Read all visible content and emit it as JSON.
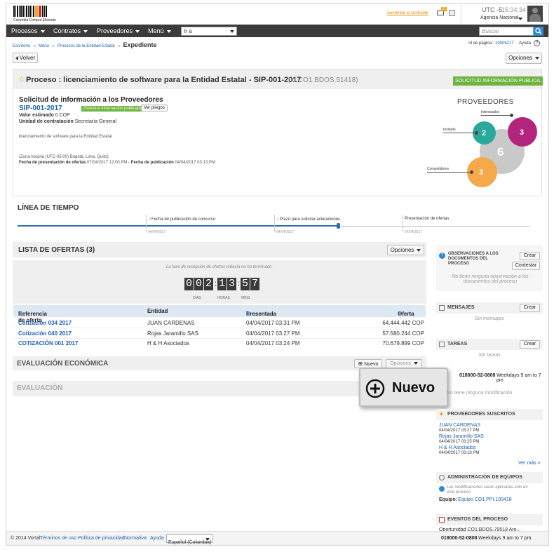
{
  "header": {
    "logo_text": "Colombia Compra Eficiente",
    "increase_contrast": "Aumentar el contraste",
    "notif_count": "31",
    "utc": "UTC -5",
    "time": "15:34:34",
    "agency": "Agencia Nacional..."
  },
  "nav": {
    "items": [
      "Procesos",
      "Contratos",
      "Proveedores",
      "Menú"
    ],
    "ira_placeholder": "Ir a",
    "search_placeholder": "Buscar"
  },
  "breadcrumb": {
    "items": [
      "Escritorio",
      "Menú",
      "Procesos de la Entidad Estatal"
    ],
    "current": "Expediente",
    "page_id_label": "Id de página::",
    "page_id": "10005217",
    "help": "Ayuda"
  },
  "actions": {
    "back": "Volver",
    "options": "Opciones"
  },
  "process": {
    "title": "Proceso : licenciamiento de software para la Entidad Estatal - SIP-001-2017",
    "code": "(id.CO1.BDOS.51418)",
    "status_badge": "SOLICITUD INFORMACIÓN PUBLICA...",
    "subtitle": "Solicitud de información a los Proveedores",
    "number": "SIP-001-2017",
    "number_status": "(Solicitud información publicada)",
    "view_button": "Ver pliegos",
    "est_value_label": "Valor estimado",
    "est_value": "0 COP",
    "unit_label": "Unidad de contratación",
    "unit": "Secretaría General",
    "description": "licenciamiento de software para la Entidad Estatal",
    "timezone": "(Zona horaria (UTC-05:00) Bogotá, Lima, Quito)",
    "offers_date_label": "Fecha de presentación de ofertas",
    "offers_date": "07/04/2017 12:00 PM",
    "pub_date_label": "Fecha de publicación",
    "pub_date": "04/04/2017 03:13 PM"
  },
  "suppliers_chart": {
    "title": "PROVEEDORES",
    "labels": {
      "interested": "Interesados",
      "invited": "Invitado",
      "competitors": "Competidores"
    },
    "values": {
      "total": "6",
      "interested": "3",
      "invited": "2",
      "competitors": "3"
    },
    "colors": {
      "interested": "#b3247c",
      "invited": "#2aa99b",
      "competitors": "#f5a94a",
      "total": "#c9c9c9"
    }
  },
  "timeline": {
    "title": "LÍNEA DE TIEMPO",
    "events": [
      {
        "label": "Fecha de publicación de concurso",
        "date": "04/04/2017"
      },
      {
        "label": "Plazo para solicitar aclaraciones",
        "date": "04/04/2017"
      },
      {
        "label": "Presentación de ofertas",
        "date": "07/04/2017"
      }
    ]
  },
  "offers": {
    "title": "LISTA DE OFERTAS (3)",
    "options": "Opciones",
    "notice": "La fase de recepción de ofertas todavía no ha terminado.",
    "countdown": {
      "days": "002",
      "hours": "13",
      "mins": "57",
      "days_label": "DÍAS",
      "hours_label": "HORAS",
      "mins_label": "MINS"
    },
    "columns": [
      "Referencia de oferta",
      "Entidad",
      "Presentada",
      "Oferta"
    ],
    "rows": [
      {
        "ref": "Cotización 034 2017",
        "entity": "JUAN CARDENAS",
        "date": "04/04/2017 03:31 PM",
        "amount": "64.444.442 COP"
      },
      {
        "ref": "Cotización 040 2017",
        "entity": "Rojas Jaramillo SAS",
        "date": "04/04/2017 03:27 PM",
        "amount": "57.580.244 COP"
      },
      {
        "ref": "COTIZACIÓN 001 2017",
        "entity": "H & H Asociados",
        "date": "04/04/2017 03:24 PM",
        "amount": "70.679.899 COP"
      }
    ]
  },
  "eval_econ": {
    "title": "EVALUACIÓN ECONÓMICA",
    "new": "Nuevo",
    "options": "Opciones"
  },
  "eval": {
    "title": "EVALUACIÓN"
  },
  "zoom_callout": {
    "label": "Nuevo"
  },
  "sidebar": {
    "observations": {
      "title": "OBSERVACIONES A LOS DOCUMENTOS DEL PROCESO",
      "create": "Crear",
      "reply": "Contestar",
      "empty": "No tiene ninguna observación a los documentos del proceso"
    },
    "messages": {
      "title": "MENSAJES",
      "create": "Crear",
      "empty": "Sin mensajes"
    },
    "tasks": {
      "title": "TAREAS",
      "create": "Crear",
      "empty": "Sin tareas"
    },
    "modifications": {
      "empty": "No tiene ninguna modificación"
    },
    "subscribed": {
      "title": "PROVEEDORES SUSCRITOS",
      "items": [
        {
          "name": "JUAN CARDENAS",
          "date": "04/04/2017 03:27 PM"
        },
        {
          "name": "Rojas Jaramillo SAS",
          "date": "04/04/2017 03:25 PM"
        },
        {
          "name": "H & H Asociados",
          "date": "04/04/2017 03:18 PM"
        }
      ],
      "more": "Ver más »"
    },
    "teams": {
      "title": "ADMINISTRACIÓN DE EQUIPOS",
      "note": "Las modificaciones serán aplicadas sólo en este proceso",
      "team_label": "Equipo:",
      "team": "Equipo CO1.PPI.100418"
    },
    "events": {
      "title": "EVENTOS DEL PROCESO",
      "line": "Oportunidad CO1.BDOS.79518 Aro..."
    }
  },
  "support": {
    "phone": "018000-52-0808",
    "hours": "Weekdays 9 am to 7 pm"
  },
  "footer": {
    "copyright": "© 2014 Vortal",
    "links": [
      "Términos de uso",
      "Política de privacidad",
      "Normativa",
      "Ayuda"
    ],
    "language": "Español (Colombia)"
  }
}
